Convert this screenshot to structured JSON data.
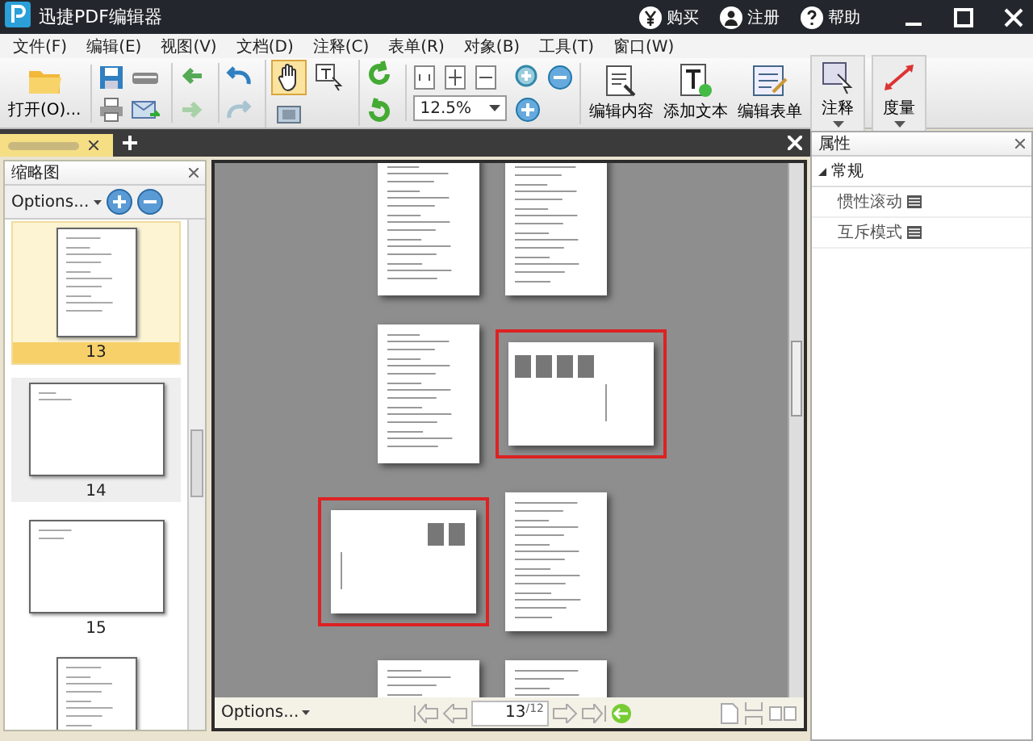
{
  "window": {
    "title": "迅捷PDF编辑器"
  },
  "header_links": [
    {
      "label": "购买",
      "kind": "buy"
    },
    {
      "label": "注册",
      "kind": "register"
    },
    {
      "label": "帮助",
      "kind": "help"
    }
  ],
  "menu": [
    "文件(F)",
    "编辑(E)",
    "视图(V)",
    "文档(D)",
    "注释(C)",
    "表单(R)",
    "对象(B)",
    "工具(T)",
    "窗口(W)"
  ],
  "toolbar": {
    "open_label": "打开(O)...",
    "tool_modes": [
      {
        "kind": "hand",
        "selected": true
      },
      {
        "kind": "select",
        "selected": false
      }
    ],
    "zoom": "12.5%",
    "big_buttons": [
      {
        "label": "编辑内容",
        "kind": "edit"
      },
      {
        "label": "添加文本",
        "kind": "text"
      },
      {
        "label": "编辑表单",
        "kind": "form"
      },
      {
        "label": "注释",
        "kind": "comment"
      },
      {
        "label": "度量",
        "kind": "measure"
      }
    ]
  },
  "thumbnails": {
    "title": "缩略图",
    "options": "Options...",
    "items": [
      {
        "label": "13",
        "kind": "portrait",
        "selected": true
      },
      {
        "label": "14",
        "kind": "landscape",
        "selected": false
      },
      {
        "label": "15",
        "kind": "landscape",
        "selected": false
      },
      {
        "kind": "portrait",
        "selected": false
      }
    ]
  },
  "canvas_rows": [
    [
      {
        "kind": "portrait",
        "highlighted": false
      },
      {
        "kind": "portrait",
        "highlighted": false
      }
    ],
    [
      {
        "kind": "portrait",
        "highlighted": false
      },
      {
        "kind": "landscape",
        "highlighted": true
      }
    ],
    [
      {
        "kind": "landscape",
        "highlighted": true
      },
      {
        "kind": "portrait",
        "highlighted": false
      }
    ],
    [
      {
        "kind": "portrait",
        "highlighted": false
      },
      {
        "kind": "portrait",
        "highlighted": false
      }
    ]
  ],
  "nav_bar": {
    "options": "Options...",
    "page": "13",
    "total": "/12"
  },
  "properties": {
    "title": "属性",
    "group": {
      "label": "常规",
      "expanded": true
    },
    "rows": [
      "惯性滚动",
      "互斥模式"
    ]
  }
}
